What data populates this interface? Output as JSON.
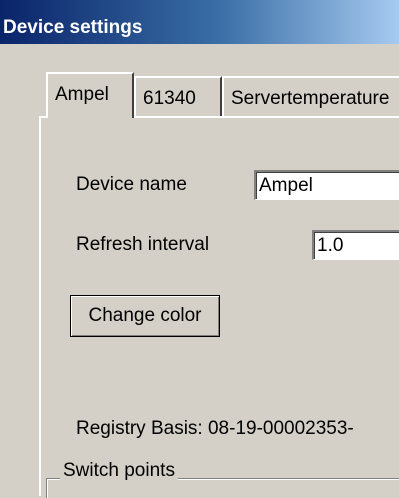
{
  "window": {
    "title": "Device settings"
  },
  "tabs": [
    {
      "label": "Ampel",
      "active": true
    },
    {
      "label": "61340",
      "active": false
    },
    {
      "label": "Servertemperature",
      "active": false
    }
  ],
  "form": {
    "device_name_label": "Device name",
    "device_name_value": "Ampel",
    "refresh_interval_label": "Refresh interval",
    "refresh_interval_value": "1.0",
    "change_color_label": "Change color",
    "registry_basis_text": "Registry Basis: 08-19-00002353-"
  },
  "switch_points": {
    "label": "Switch points"
  },
  "colors": {
    "face": "#d4d0c8",
    "title_bar_start": "#0a246a",
    "title_bar_end": "#a6caf0",
    "title_text": "#ffffff"
  }
}
